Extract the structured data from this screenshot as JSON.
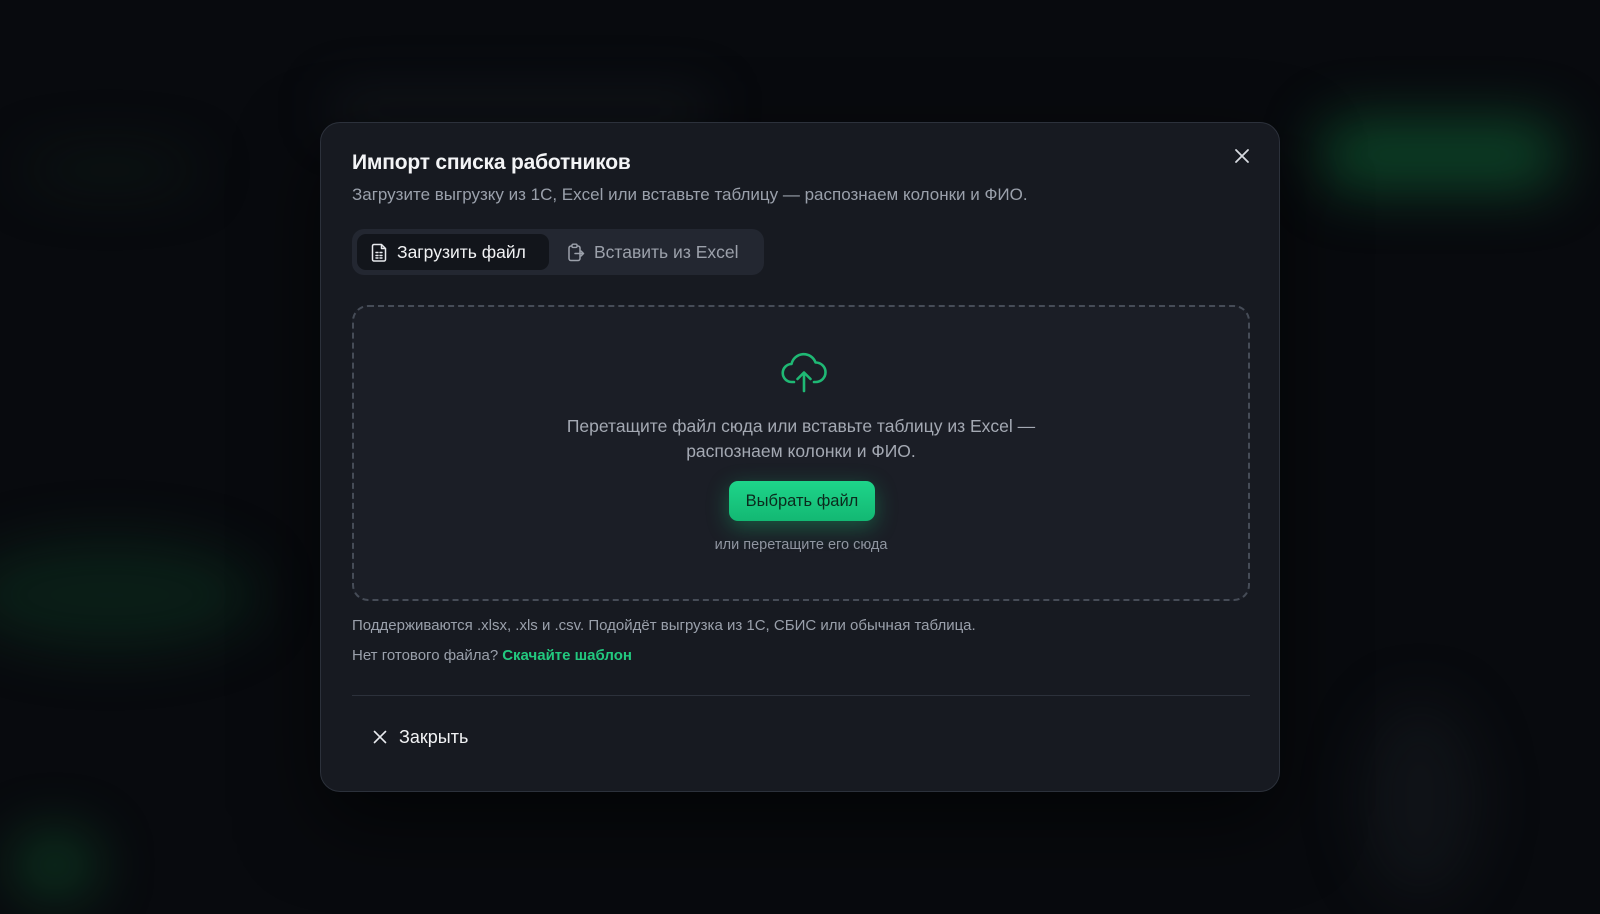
{
  "modal": {
    "title": "Импорт списка работников",
    "subtitle": "Загрузите выгрузку из 1С, Excel или вставьте таблицу — распознаем колонки и ФИО.",
    "tabs": [
      {
        "label": "Загрузить файл",
        "icon": "file-spreadsheet-icon",
        "active": true
      },
      {
        "label": "Вставить из Excel",
        "icon": "clipboard-icon",
        "active": false
      }
    ],
    "dropzone": {
      "icon": "cloud-upload-icon",
      "text_line1": "Перетащите файл сюда или вставьте таблицу из Excel —",
      "text_line2": "распознаем колонки и ФИО.",
      "button_label": "Выбрать файл",
      "hint": "или перетащите его сюда"
    },
    "support_text": "Поддерживаются .xlsx, .xls и .csv. Подойдёт выгрузка из 1С, СБИС или обычная таблица.",
    "template_prompt": "Нет готового файла?",
    "template_link": "Скачайте шаблон",
    "close_label": "Закрыть"
  },
  "colors": {
    "accent": "#1ed58a",
    "modal_bg": "#171a21",
    "backdrop": "#080a0e"
  }
}
